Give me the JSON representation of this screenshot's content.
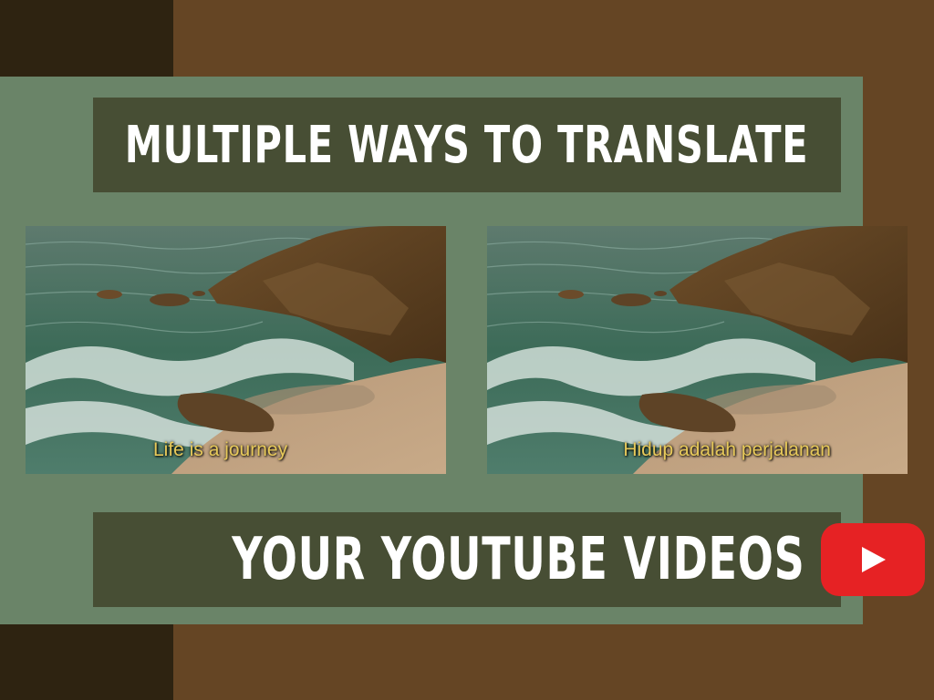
{
  "header": {
    "title": "MULTIPLE WAYS TO TRANSLATE"
  },
  "footer": {
    "subtitle": "YOUR YOUTUBE VIDEOS"
  },
  "videos": [
    {
      "caption": "Life is a journey"
    },
    {
      "caption": "Hidup adalah perjalanan"
    }
  ],
  "icons": {
    "play": "youtube-play-icon"
  },
  "colors": {
    "background_brown": "#654524",
    "dark_strip": "#2e2311",
    "panel_green": "#6a8468",
    "banner_olive": "#474e34",
    "youtube_red": "#e62224",
    "caption_yellow": "#e7c95a"
  }
}
